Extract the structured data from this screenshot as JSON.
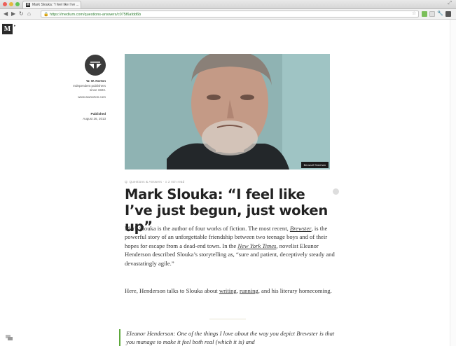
{
  "browser": {
    "tab_title": "Mark Slouka: “I feel like I’ve ...",
    "url": "https://medium.com/questions-answers/c075f6afdd6b",
    "tab_favicon": "M"
  },
  "site": {
    "logo": "M",
    "logo_arrow": "▸"
  },
  "author": {
    "name": "W. W. Norton",
    "bio_line1": "Independent publishers",
    "bio_line2": "since 1923.",
    "website": "www.wwnorton.com",
    "published_label": "Published",
    "published_date": "August 26, 2013"
  },
  "hero": {
    "caption": "Beowulf Sheehan"
  },
  "article": {
    "meta": "Q: Questions & Answers · ≡ 2 min read",
    "title": "Mark Slouka: “I feel like I’ve just begun, just woken up”",
    "p1_a": "Mark Slouka is the author of four works of fiction. The most recent, ",
    "p1_book": "Brewster",
    "p1_b": ", is the powerful story of an unforgettable friendship between two teenage boys and of their hopes for escape from a dead-end town. In the ",
    "p1_paper": "New York Times",
    "p1_c": ", novelist Eleanor Henderson described Slouka’s storytelling as, “sure and patient, deceptively steady and devastatingly agile.”",
    "p2_a": "Here, Henderson talks to Slouka about ",
    "p2_link1": "writing",
    "p2_sep": ", ",
    "p2_link2": "running",
    "p2_b": ", and his literary homecoming.",
    "quote_speaker": "Eleanor Henderson:",
    "quote_text": " One of the things I love about the way you depict Brewster is that you manage to make it feel both real (which it is) and"
  },
  "colors": {
    "accent_green": "#5da83b",
    "hero_bg": "#8fb3b3"
  }
}
